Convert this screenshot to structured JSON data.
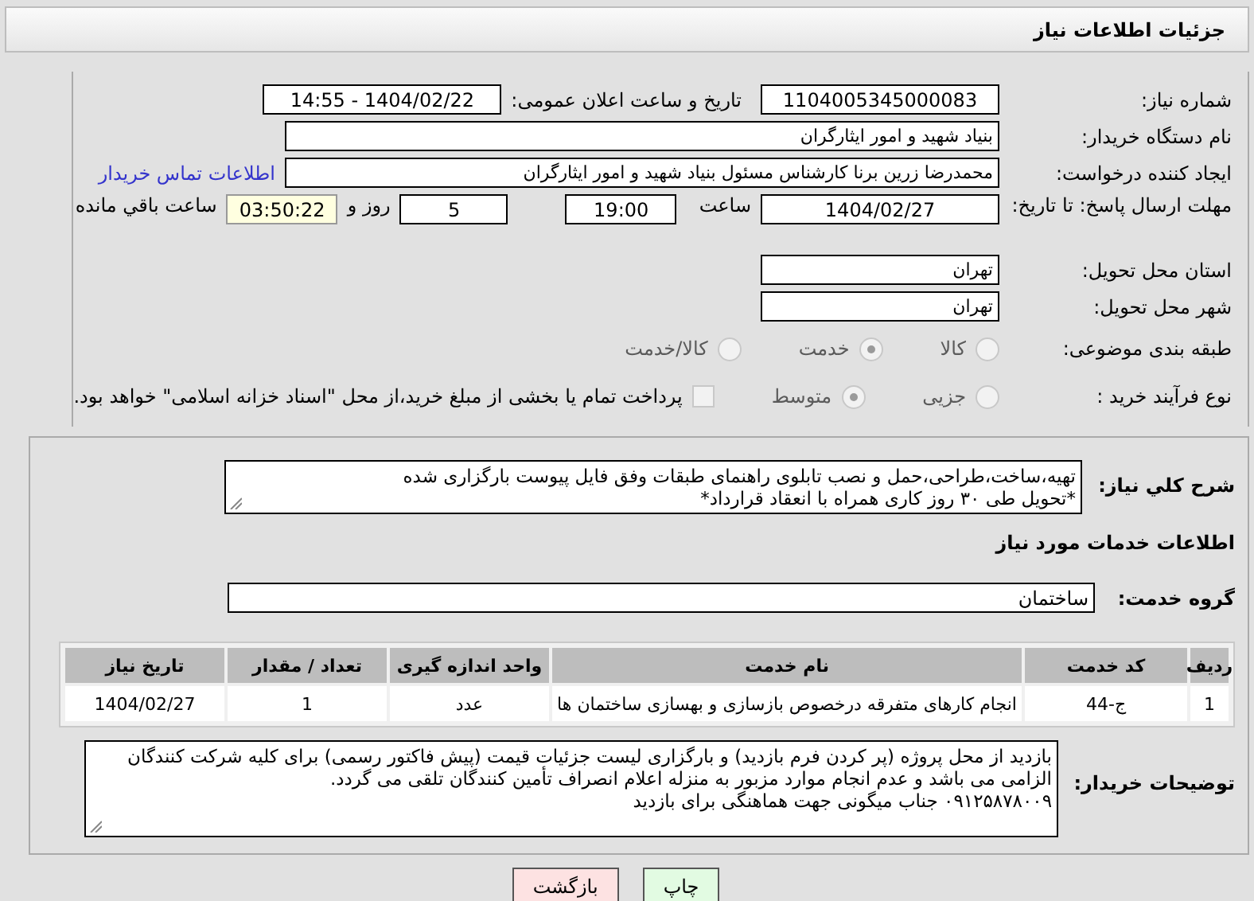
{
  "header": {
    "title": "جزئیات اطلاعات نیاز"
  },
  "need_number": {
    "label": "شماره نیاز:",
    "value": "1104005345000083"
  },
  "announce": {
    "label": "تاریخ و ساعت اعلان عمومی:",
    "value": "1404/02/22 - 14:55"
  },
  "buyer_org": {
    "label": "نام دستگاه خریدار:",
    "value": "بنیاد شهید و امور ایثارگران"
  },
  "creator": {
    "label": "ایجاد کننده درخواست:",
    "value": "محمدرضا زرین برنا کارشناس مسئول  بنیاد شهید و امور ایثارگران",
    "link": "اطلاعات تماس خریدار"
  },
  "deadline": {
    "label": "مهلت ارسال پاسخ: تا تاریخ:",
    "date": "1404/02/27",
    "time_label": "ساعت",
    "time": "19:00",
    "days": "5",
    "days_label": "روز و",
    "remaining": "03:50:22",
    "remaining_label": "ساعت باقي مانده"
  },
  "province": {
    "label": "استان محل تحویل:",
    "value": "تهران"
  },
  "city": {
    "label": "شهر محل تحویل:",
    "value": "تهران"
  },
  "category": {
    "label": "طبقه بندی موضوعی:",
    "options": [
      {
        "label": "کالا",
        "selected": false
      },
      {
        "label": "خدمت",
        "selected": true
      },
      {
        "label": "کالا/خدمت",
        "selected": false
      }
    ]
  },
  "process": {
    "label": "نوع فرآیند خرید :",
    "options": [
      {
        "label": "جزیی",
        "selected": false
      },
      {
        "label": "متوسط",
        "selected": true
      }
    ],
    "treasury": {
      "label": "پرداخت تمام یا بخشی از مبلغ خرید،از محل \"اسناد خزانه اسلامی\" خواهد بود.",
      "checked": false
    }
  },
  "description": {
    "label": "شرح کلي نياز:",
    "lines": [
      "تهیه،ساخت،طراحی،حمل و نصب تابلوی راهنمای طبقات وفق فایل پیوست  بارگزاری شده",
      "*تحویل طی ۳۰ روز کاری همراه با انعقاد قرارداد*"
    ]
  },
  "services_heading": "اطلاعات خدمات مورد نیاز",
  "service_group": {
    "label": "گروه خدمت:",
    "value": "ساختمان"
  },
  "table": {
    "columns": [
      "ردیف",
      "کد خدمت",
      "نام خدمت",
      "واحد اندازه گیری",
      "تعداد / مقدار",
      "تاریخ نیاز"
    ],
    "rows": [
      [
        "1",
        "ج-44",
        "انجام کارهای متفرقه درخصوص بازسازی و بهسازی ساختمان ها",
        "عدد",
        "1",
        "1404/02/27"
      ]
    ]
  },
  "buyer_notes": {
    "label": "توضیحات خریدار:",
    "lines": [
      "بازدید از محل پروژه (پر کردن فرم بازدید) و بارگزاری لیست جزئیات قیمت (پیش فاکتور رسمی) برای کلیه شرکت کنندگان",
      "الزامی می باشد و عدم انجام موارد مزبور به  منزله اعلام انصراف تأمین کنندگان تلقی می گردد.",
      "۰۹۱۲۵۸۷۸۰۰۹ جناب میگونی جهت هماهنگی برای بازدید"
    ]
  },
  "buttons": [
    {
      "label": "چاپ",
      "kind": "print"
    },
    {
      "label": "بازگشت",
      "kind": "back"
    }
  ]
}
